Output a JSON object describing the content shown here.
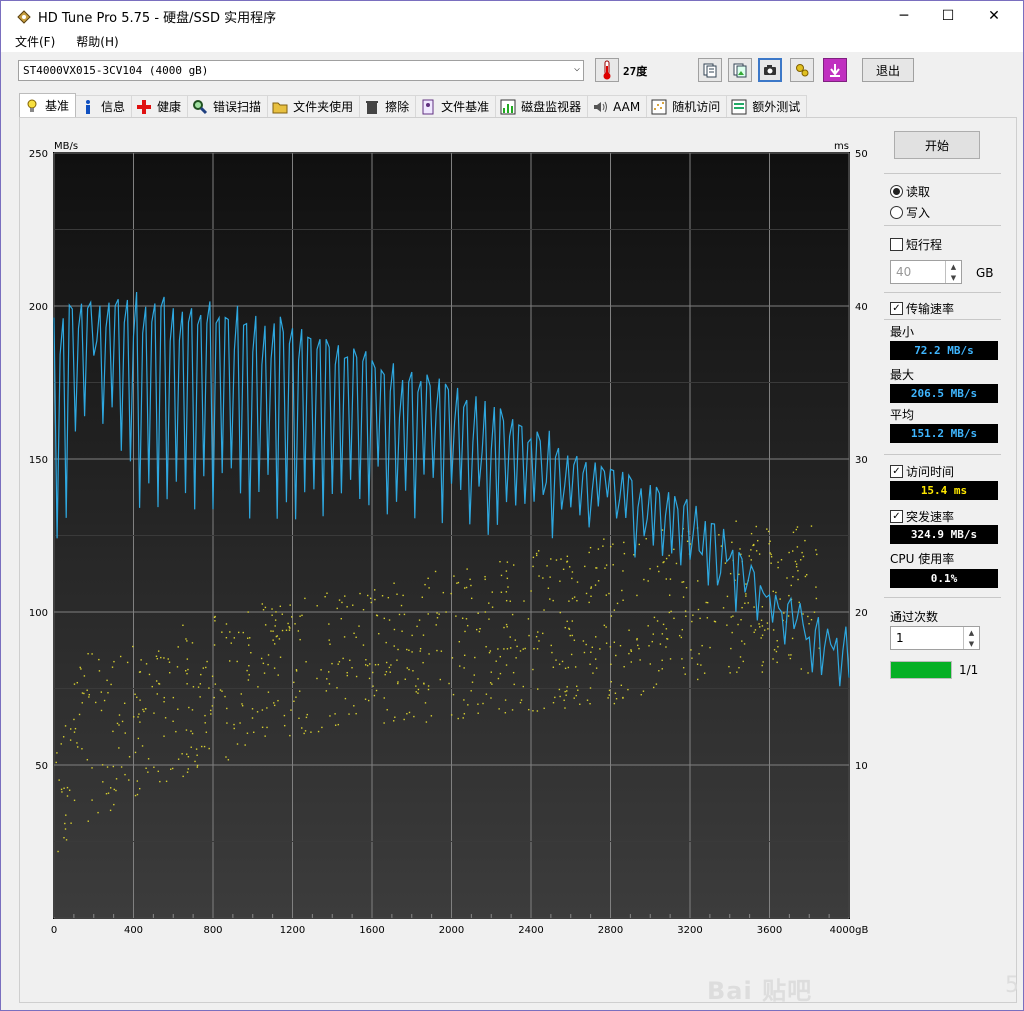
{
  "window": {
    "title": "HD Tune Pro 5.75 - 硬盘/SSD 实用程序",
    "minimize": "─",
    "maximize": "☐",
    "close": "✕"
  },
  "menu": [
    "文件(F)",
    "帮助(H)"
  ],
  "toolbar": {
    "drive": "ST4000VX015-3CV104 (4000 gB)",
    "temperature": "27度",
    "exit_label": "退出",
    "buttons": [
      "copy-text-icon",
      "copy-image-icon",
      "camera-icon",
      "options-icon",
      "save-icon"
    ]
  },
  "tabs": [
    {
      "label": "基准",
      "icon": "bulb-icon",
      "active": true
    },
    {
      "label": "信息",
      "icon": "info-icon"
    },
    {
      "label": "健康",
      "icon": "health-cross-icon"
    },
    {
      "label": "错误扫描",
      "icon": "magnifier-icon"
    },
    {
      "label": "文件夹使用",
      "icon": "folder-icon"
    },
    {
      "label": "擦除",
      "icon": "trash-icon"
    },
    {
      "label": "文件基准",
      "icon": "file-bench-icon"
    },
    {
      "label": "磁盘监视器",
      "icon": "monitor-chart-icon"
    },
    {
      "label": "AAM",
      "icon": "speaker-icon"
    },
    {
      "label": "随机访问",
      "icon": "random-access-icon"
    },
    {
      "label": "额外测试",
      "icon": "extra-tests-icon"
    }
  ],
  "side": {
    "start_label": "开始",
    "read_label": "读取",
    "write_label": "写入",
    "mode": "read",
    "short_stroke_label": "短行程",
    "short_stroke_checked": false,
    "short_stroke_value": "40",
    "short_stroke_unit": "GB",
    "transfer_rate_label": "传输速率",
    "transfer_rate_checked": true,
    "min_label": "最小",
    "min_value": "72.2 MB/s",
    "max_label": "最大",
    "max_value": "206.5 MB/s",
    "avg_label": "平均",
    "avg_value": "151.2 MB/s",
    "access_time_label": "访问时间",
    "access_time_checked": true,
    "access_time_value": "15.4 ms",
    "burst_rate_label": "突发速率",
    "burst_rate_checked": true,
    "burst_rate_value": "324.9 MB/s",
    "cpu_label": "CPU 使用率",
    "cpu_value": "0.1%",
    "passes_label": "通过次数",
    "passes_value": "1",
    "progress_text": "1/1",
    "progress_fraction": 1.0,
    "colors": {
      "lcd_blue": "#3fb6ff",
      "lcd_yellow": "#ffe800",
      "lcd_white": "#ffffff",
      "progress": "#06b025"
    }
  },
  "watermark": {
    "text": "Bai 贴吧",
    "suffix": "5"
  },
  "chart_data": {
    "type": "line",
    "x_unit": "gB",
    "left_unit": "MB/s",
    "right_unit": "ms",
    "x_ticks": [
      "0",
      "400",
      "800",
      "1200",
      "1600",
      "2000",
      "2400",
      "2800",
      "3200",
      "3600",
      "4000gB"
    ],
    "y_ticks_left": [
      "250",
      "200",
      "150",
      "100",
      "50"
    ],
    "y_ticks_right": [
      "50",
      "40",
      "30",
      "20",
      "10"
    ],
    "xlim": [
      0,
      4000
    ],
    "ylim_left": [
      0,
      250
    ],
    "ylim_right": [
      0,
      50
    ],
    "grid": true,
    "series": [
      {
        "kind": "transfer_rate_envelope",
        "color": "#2ea8e0",
        "upper": [
          [
            0,
            200
          ],
          [
            200,
            205
          ],
          [
            400,
            205
          ],
          [
            800,
            202
          ],
          [
            1200,
            196
          ],
          [
            1600,
            185
          ],
          [
            2000,
            175
          ],
          [
            2400,
            162
          ],
          [
            2800,
            150
          ],
          [
            3200,
            137
          ],
          [
            3400,
            126
          ],
          [
            3600,
            110
          ],
          [
            3800,
            95
          ],
          [
            4000,
            90
          ]
        ],
        "lower": [
          [
            0,
            115
          ],
          [
            200,
            165
          ],
          [
            400,
            132
          ],
          [
            800,
            128
          ],
          [
            1200,
            130
          ],
          [
            1600,
            128
          ],
          [
            2000,
            125
          ],
          [
            2400,
            122
          ],
          [
            2800,
            120
          ],
          [
            3200,
            112
          ],
          [
            3400,
            100
          ],
          [
            3600,
            96
          ],
          [
            3800,
            80
          ],
          [
            4000,
            75
          ]
        ]
      },
      {
        "kind": "access_time_scatter",
        "color": "#d8d030",
        "unit": "ms",
        "band_min": [
          [
            0,
            4
          ],
          [
            400,
            8
          ],
          [
            800,
            10
          ],
          [
            1200,
            12
          ],
          [
            2000,
            13
          ],
          [
            2800,
            14
          ],
          [
            3400,
            16
          ]
        ],
        "band_max": [
          [
            0,
            17
          ],
          [
            400,
            18
          ],
          [
            800,
            20
          ],
          [
            1200,
            21
          ],
          [
            2000,
            23
          ],
          [
            2800,
            25
          ],
          [
            3400,
            26
          ]
        ],
        "x_extent": [
          0,
          3850
        ]
      }
    ]
  }
}
